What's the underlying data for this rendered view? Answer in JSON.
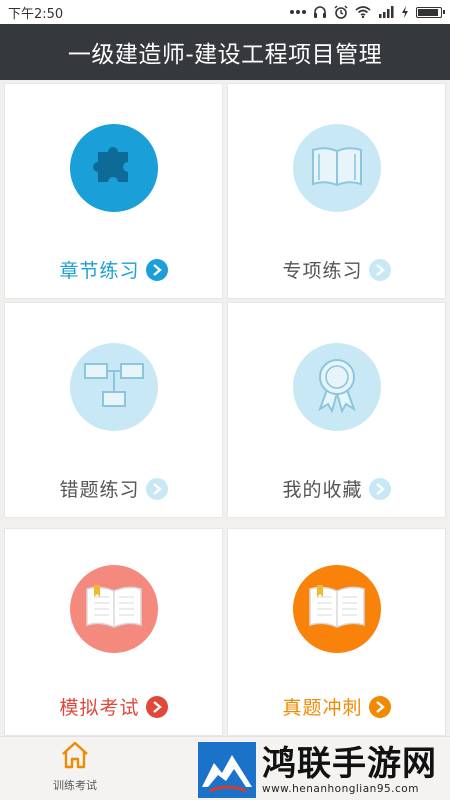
{
  "status_bar": {
    "time": "下午2:50"
  },
  "header": {
    "title": "一级建造师-建设工程项目管理"
  },
  "cards": [
    {
      "label": "章节练习",
      "icon": "puzzle-icon",
      "label_color": "#1a9fd8",
      "circle_color": "#1a9fd8",
      "arrow_color": "#1a9fd8"
    },
    {
      "label": "专项练习",
      "icon": "book-icon",
      "label_color": "#555555",
      "circle_color": "#c8e8f5",
      "arrow_color": "#c8e8f5"
    },
    {
      "label": "错题练习",
      "icon": "flowchart-icon",
      "label_color": "#555555",
      "circle_color": "#c8e8f5",
      "arrow_color": "#c8e8f5"
    },
    {
      "label": "我的收藏",
      "icon": "ribbon-badge-icon",
      "label_color": "#555555",
      "circle_color": "#c8e8f5",
      "arrow_color": "#c8e8f5"
    },
    {
      "label": "模拟考试",
      "icon": "open-book-icon",
      "label_color": "#e0493a",
      "circle_color": "#f4897d",
      "arrow_color": "#e0493a"
    },
    {
      "label": "真题冲刺",
      "icon": "open-book-icon",
      "label_color": "#f08a00",
      "circle_color": "#f8820a",
      "arrow_color": "#f08a00"
    }
  ],
  "bottom_nav": {
    "tab_label": "训练考试",
    "accent": "#f08a00"
  },
  "watermark": {
    "title": "鸿联手游网",
    "url": "www.henanhonglian95.com"
  }
}
